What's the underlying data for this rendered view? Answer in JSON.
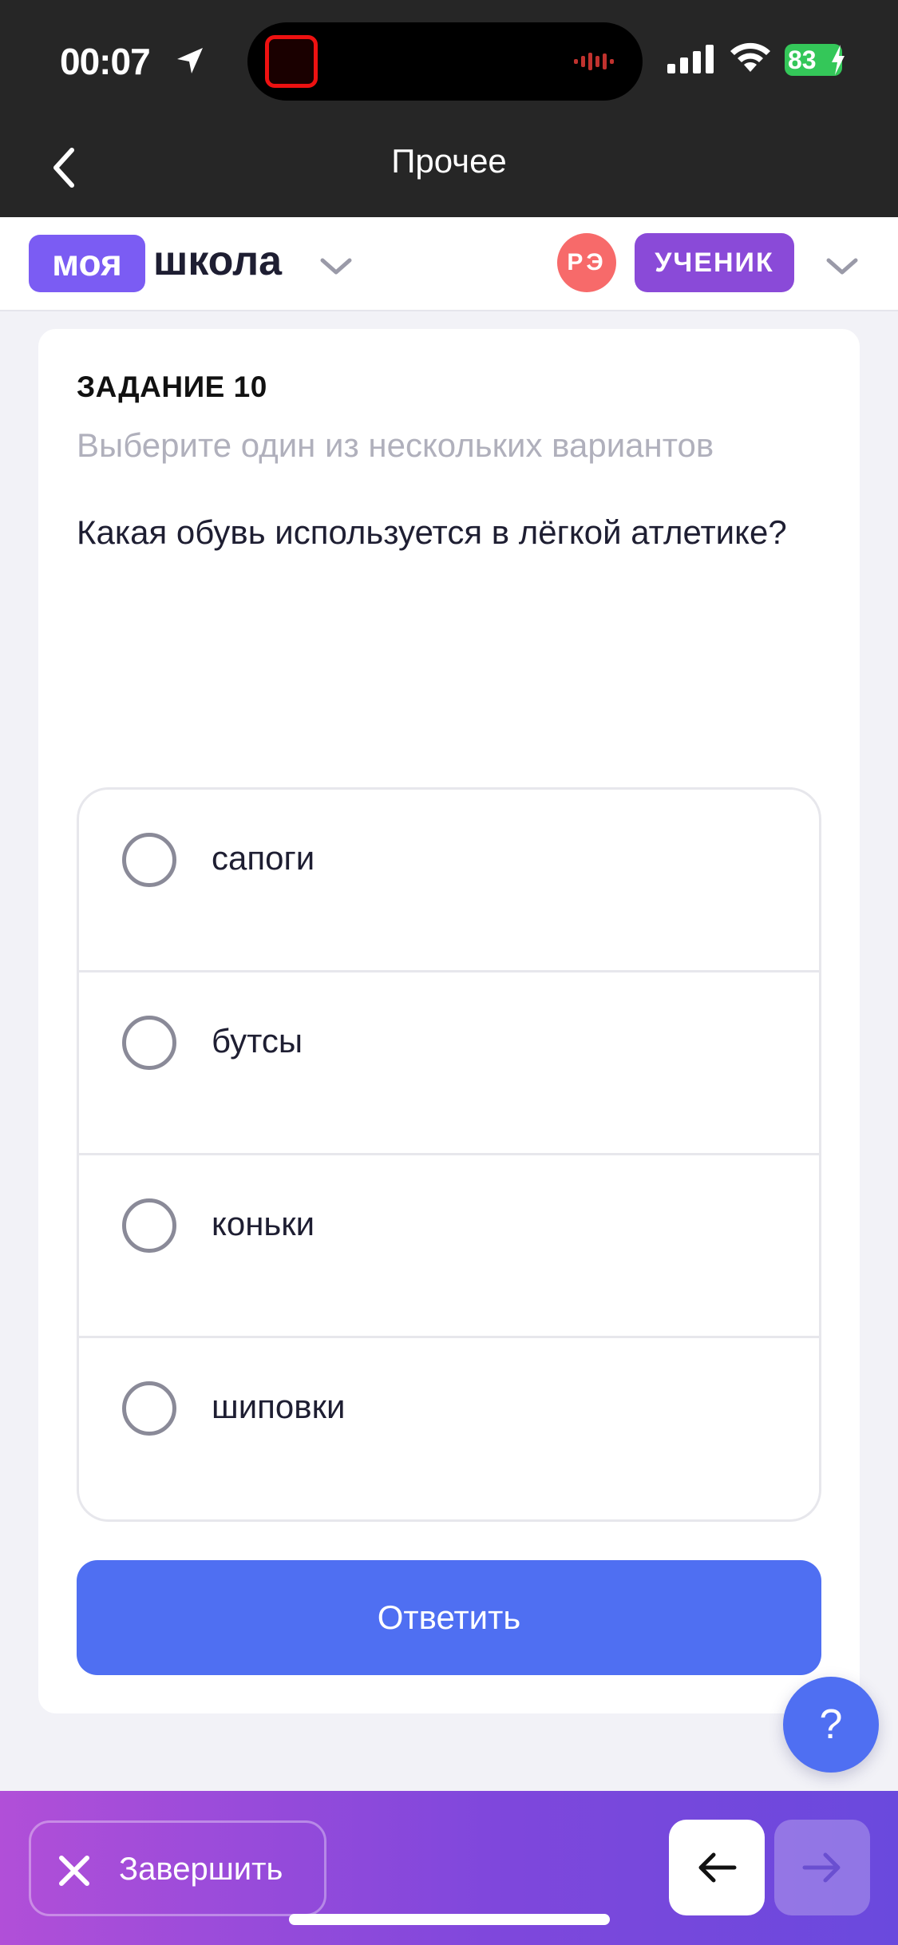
{
  "status_bar": {
    "time": "00:07",
    "battery": "83"
  },
  "nav": {
    "title": "Прочее"
  },
  "header": {
    "logo_part1": "моя",
    "logo_part2": "школа",
    "avatar_initials": "РЭ",
    "role": "УЧЕНИК"
  },
  "task": {
    "number_label": "ЗАДАНИЕ 10",
    "hint": "Выберите один из нескольких вариантов",
    "question": "Какая обувь используется в лёгкой атлетике?",
    "options": [
      {
        "label": "сапоги"
      },
      {
        "label": "бутсы"
      },
      {
        "label": "коньки"
      },
      {
        "label": "шиповки"
      }
    ],
    "answer_label": "Ответить"
  },
  "help": {
    "label": "?"
  },
  "bottom": {
    "finish_label": "Завершить"
  },
  "colors": {
    "brand_purple": "#7b5cf3",
    "role_purple": "#8a4ad8",
    "primary_blue": "#4f6ff2",
    "avatar_red": "#f76a6a"
  }
}
